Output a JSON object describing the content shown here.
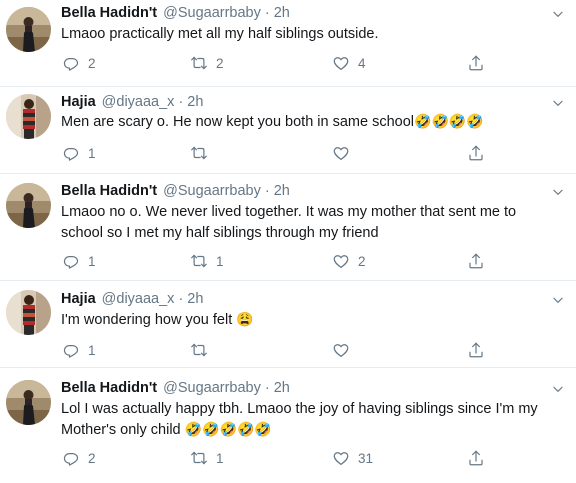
{
  "tweets": [
    {
      "name": "Bella Hadidn't",
      "handle": "@Sugaarrbaby",
      "separator": "·",
      "time": "2h",
      "text": "Lmaoo practically met all my half siblings outside.",
      "emoji": "",
      "replies": "2",
      "retweets": "2",
      "likes": "4"
    },
    {
      "name": "Hajia",
      "handle": "@diyaaa_x",
      "separator": "·",
      "time": "2h",
      "text": "Men are scary o. He now kept you both in same school",
      "emoji": "🤣🤣🤣🤣",
      "replies": "1",
      "retweets": "",
      "likes": ""
    },
    {
      "name": "Bella Hadidn't",
      "handle": "@Sugaarrbaby",
      "separator": "·",
      "time": "2h",
      "text": "Lmaoo no o. We never lived together. It was my mother that sent me to school so I met my half siblings through my friend",
      "emoji": "",
      "replies": "1",
      "retweets": "1",
      "likes": "2"
    },
    {
      "name": "Hajia",
      "handle": "@diyaaa_x",
      "separator": "·",
      "time": "2h",
      "text": "I'm wondering how you felt ",
      "emoji": "😩",
      "replies": "1",
      "retweets": "",
      "likes": ""
    },
    {
      "name": "Bella Hadidn't",
      "handle": "@Sugaarrbaby",
      "separator": "·",
      "time": "2h",
      "text": "Lol I was actually happy tbh. Lmaoo the joy of having siblings since I'm my Mother's only child ",
      "emoji": "🤣🤣🤣🤣🤣",
      "replies": "2",
      "retweets": "1",
      "likes": "31"
    }
  ],
  "icons": {
    "reply": "reply-icon",
    "retweet": "retweet-icon",
    "like": "heart-icon",
    "share": "share-icon",
    "menu": "chevron-down-icon"
  },
  "colors": {
    "text": "#14171a",
    "muted": "#657786",
    "divider": "#e6ecf0"
  }
}
